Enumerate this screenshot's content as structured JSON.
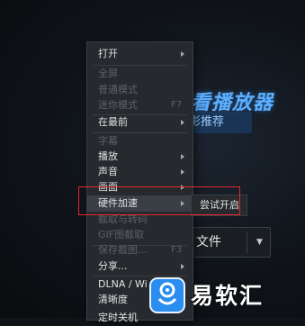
{
  "app": {
    "title_fragment": "看播放器",
    "subtitle_fragment": "影推荐",
    "open_file_label": "文件"
  },
  "menu": {
    "items": [
      {
        "label": "打开",
        "enabled": true,
        "submenu": true,
        "highlighted": false
      },
      {
        "label": "全屏",
        "enabled": false,
        "submenu": false,
        "highlighted": false
      },
      {
        "label": "普通模式",
        "enabled": false,
        "submenu": false,
        "highlighted": false
      },
      {
        "label": "迷你模式",
        "enabled": false,
        "shortcut": "F7",
        "submenu": false,
        "highlighted": false
      },
      {
        "label": "在最前",
        "enabled": true,
        "submenu": true,
        "highlighted": false
      },
      {
        "label": "字幕",
        "enabled": false,
        "submenu": false,
        "highlighted": false
      },
      {
        "label": "播放",
        "enabled": true,
        "submenu": true,
        "highlighted": false
      },
      {
        "label": "声音",
        "enabled": true,
        "submenu": true,
        "highlighted": false
      },
      {
        "label": "画面",
        "enabled": true,
        "submenu": true,
        "highlighted": false
      },
      {
        "label": "硬件加速",
        "enabled": true,
        "submenu": true,
        "highlighted": true
      },
      {
        "label": "截取与转码",
        "enabled": false,
        "submenu": false,
        "highlighted": false
      },
      {
        "label": "GIF图截取",
        "enabled": false,
        "submenu": false,
        "highlighted": false
      },
      {
        "label": "保存截图...",
        "enabled": false,
        "shortcut": "F3",
        "submenu": false,
        "highlighted": false
      },
      {
        "label": "分享...",
        "enabled": true,
        "submenu": true,
        "highlighted": false
      },
      {
        "label": "DLNA / Wi",
        "enabled": true,
        "submenu": false,
        "highlighted": false
      },
      {
        "label": "清晰度",
        "enabled": true,
        "submenu": false,
        "highlighted": false
      },
      {
        "label": "定时关机",
        "enabled": true,
        "submenu": false,
        "highlighted": false
      }
    ]
  },
  "submenu": {
    "label": "尝试开启"
  },
  "watermark": {
    "text": "易软汇"
  },
  "colors": {
    "menu_bg": "#26292d",
    "highlight": "#3a3f46",
    "annotation_red": "#e02a2a",
    "brand_blue": "#5ab0ff",
    "watermark_blue": "#2a8df0"
  }
}
